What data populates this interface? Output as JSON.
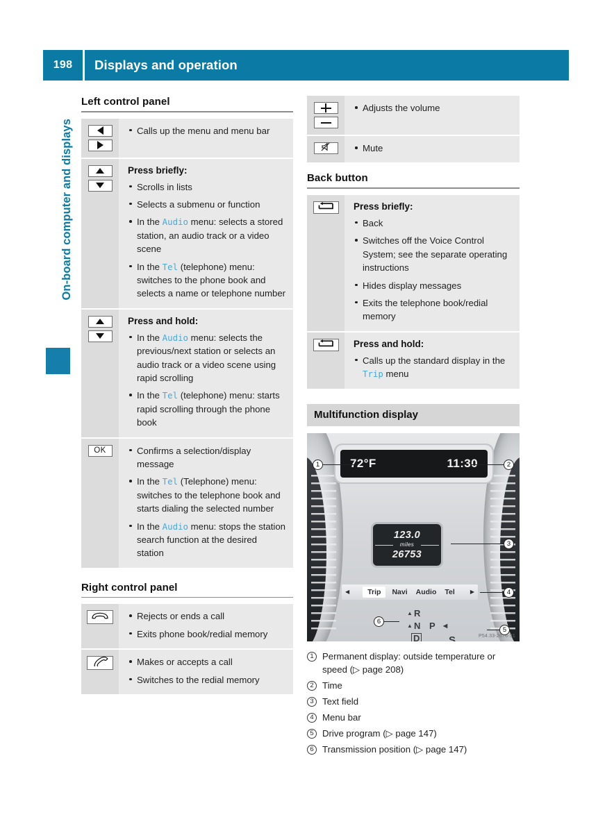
{
  "header": {
    "page_number": "198",
    "title": "Displays and operation"
  },
  "chapter_tab": {
    "label": "On-board computer and displays"
  },
  "left_column": {
    "sections": [
      {
        "heading": "Left control panel",
        "rows": [
          {
            "keys": [
              "triangle-left",
              "triangle-right"
            ],
            "title": null,
            "bullets": [
              {
                "parts": [
                  {
                    "t": "Calls up the menu and menu bar"
                  }
                ]
              }
            ]
          },
          {
            "keys": [
              "triangle-up",
              "triangle-down"
            ],
            "title": "Press briefly:",
            "bullets": [
              {
                "parts": [
                  {
                    "t": "Scrolls in lists"
                  }
                ]
              },
              {
                "parts": [
                  {
                    "t": "Selects a submenu or function"
                  }
                ]
              },
              {
                "parts": [
                  {
                    "t": "In the "
                  },
                  {
                    "t": "Audio",
                    "menu": true
                  },
                  {
                    "t": " menu: selects a stored station, an audio track or a video scene"
                  }
                ]
              },
              {
                "parts": [
                  {
                    "t": "In the "
                  },
                  {
                    "t": "Tel",
                    "menu": true
                  },
                  {
                    "t": " (telephone) menu: switches to the phone book and selects a name or telephone number"
                  }
                ]
              }
            ]
          },
          {
            "keys": [
              "triangle-up",
              "triangle-down"
            ],
            "title": "Press and hold:",
            "bullets": [
              {
                "parts": [
                  {
                    "t": "In the "
                  },
                  {
                    "t": "Audio",
                    "menu": true
                  },
                  {
                    "t": " menu: selects the previous/next station or selects an audio track or a video scene using rapid scrolling"
                  }
                ]
              },
              {
                "parts": [
                  {
                    "t": "In the "
                  },
                  {
                    "t": "Tel",
                    "menu": true
                  },
                  {
                    "t": " (telephone) menu: starts rapid scrolling through the phone book"
                  }
                ]
              }
            ]
          },
          {
            "keys": [
              "ok"
            ],
            "key_label": "OK",
            "title": null,
            "bullets": [
              {
                "parts": [
                  {
                    "t": "Confirms a selection/display message"
                  }
                ]
              },
              {
                "parts": [
                  {
                    "t": "In the "
                  },
                  {
                    "t": "Tel",
                    "menu": true
                  },
                  {
                    "t": " (Telephone) menu: switches to the telephone book and starts dialing the selected number"
                  }
                ]
              },
              {
                "parts": [
                  {
                    "t": "In the "
                  },
                  {
                    "t": "Audio",
                    "menu": true
                  },
                  {
                    "t": " menu: stops the station search function at the desired station"
                  }
                ]
              }
            ]
          }
        ]
      },
      {
        "heading": "Right control panel",
        "rows": [
          {
            "keys": [
              "phone-end"
            ],
            "title": null,
            "bullets": [
              {
                "parts": [
                  {
                    "t": "Rejects or ends a call"
                  }
                ]
              },
              {
                "parts": [
                  {
                    "t": "Exits phone book/redial memory"
                  }
                ]
              }
            ]
          },
          {
            "keys": [
              "phone-call"
            ],
            "title": null,
            "bullets": [
              {
                "parts": [
                  {
                    "t": "Makes or accepts a call"
                  }
                ]
              },
              {
                "parts": [
                  {
                    "t": "Switches to the redial memory"
                  }
                ]
              }
            ]
          }
        ]
      }
    ]
  },
  "right_column": {
    "volume_rows": [
      {
        "keys": [
          "plus",
          "minus"
        ],
        "title": null,
        "bullets": [
          {
            "parts": [
              {
                "t": "Adjusts the volume"
              }
            ]
          }
        ]
      },
      {
        "keys": [
          "mute"
        ],
        "title": null,
        "bullets": [
          {
            "parts": [
              {
                "t": "Mute"
              }
            ]
          }
        ]
      }
    ],
    "back_button": {
      "heading": "Back button",
      "rows": [
        {
          "keys": [
            "back-arrow"
          ],
          "title": "Press briefly:",
          "bullets": [
            {
              "parts": [
                {
                  "t": "Back"
                }
              ]
            },
            {
              "parts": [
                {
                  "t": "Switches off the Voice Control System; see the separate operating instructions"
                }
              ]
            },
            {
              "parts": [
                {
                  "t": "Hides display messages"
                }
              ]
            },
            {
              "parts": [
                {
                  "t": "Exits the telephone book/redial memory"
                }
              ]
            }
          ]
        },
        {
          "keys": [
            "back-arrow"
          ],
          "title": "Press and hold:",
          "bullets": [
            {
              "parts": [
                {
                  "t": "Calls up the standard display in the "
                },
                {
                  "t": "Trip",
                  "menu": true
                },
                {
                  "t": " menu"
                }
              ]
            }
          ]
        }
      ]
    },
    "multifunction_display": {
      "heading": "Multifunction display",
      "cluster": {
        "outside_temperature": "72°F",
        "time": "11:30",
        "text_field_distance": "123.0",
        "text_field_unit": "miles",
        "text_field_odometer": "26753",
        "menu_bar": [
          "Trip",
          "Navi",
          "Audio",
          "Tel"
        ],
        "menu_bar_active": "Trip",
        "gears": [
          "R",
          "N",
          "P",
          "D",
          "S"
        ],
        "watermark": "P54.33-2676-31",
        "callouts": [
          "1",
          "2",
          "3",
          "4",
          "5",
          "6"
        ]
      },
      "legend": [
        {
          "num": "1",
          "text": "Permanent display: outside temperature or speed (▷ page 208)"
        },
        {
          "num": "2",
          "text": "Time"
        },
        {
          "num": "3",
          "text": "Text field"
        },
        {
          "num": "4",
          "text": "Menu bar"
        },
        {
          "num": "5",
          "text": "Drive program (▷ page 147)"
        },
        {
          "num": "6",
          "text": "Transmission position (▷ page 147)"
        }
      ]
    }
  },
  "colors": {
    "accent_teal": "#0b7aa5",
    "menu_word_blue": "#4aa8d8",
    "row_bg": "#e9e9e9",
    "key_col_bg": "#dcdcdc"
  }
}
